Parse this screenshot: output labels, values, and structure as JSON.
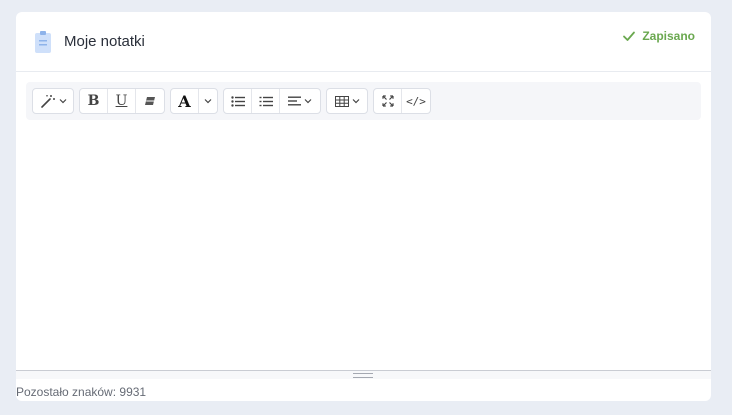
{
  "header": {
    "title": "Moje notatki",
    "status": "Zapisano",
    "status_color": "#6aa84f",
    "icon": "clipboard-icon"
  },
  "toolbar": {
    "groups": [
      [
        "magic-wand-icon",
        "chevron-down-icon"
      ],
      [
        "bold-icon",
        "underline-icon",
        "eraser-icon"
      ],
      [
        "font-color-icon",
        "chevron-down-icon"
      ],
      [
        "unordered-list-icon",
        "ordered-list-icon",
        "align-icon",
        "chevron-down-icon"
      ],
      [
        "table-icon",
        "chevron-down-icon"
      ],
      [
        "fullscreen-icon",
        "code-view-icon"
      ]
    ],
    "bold_glyph": "B",
    "underline_glyph": "U",
    "font_color_glyph": "A",
    "code_glyph": "</>"
  },
  "editor": {
    "content": ""
  },
  "footer": {
    "remaining": "Pozostało znaków: 9931"
  }
}
